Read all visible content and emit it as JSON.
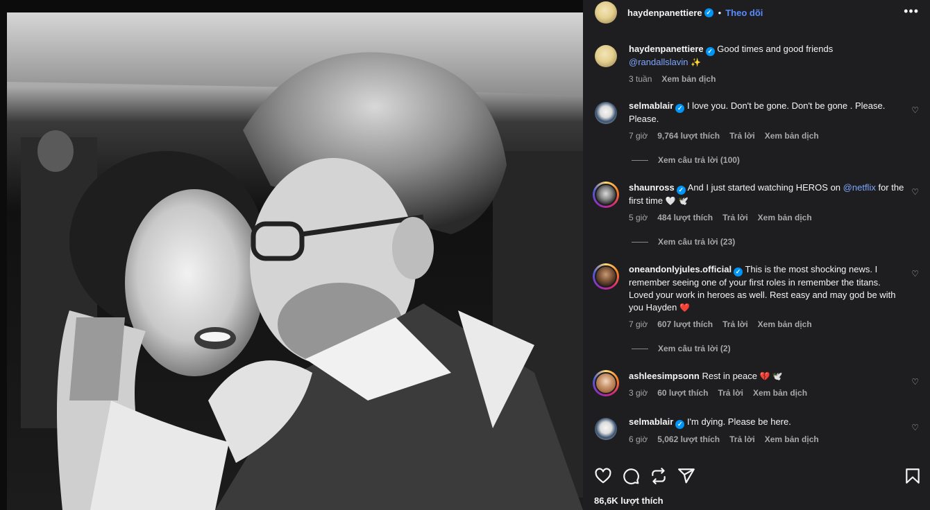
{
  "post": {
    "author": "haydenpanettiere",
    "follow_label": "Theo dõi",
    "separator": "•",
    "more_icon": "more-horizontal-icon",
    "caption": {
      "username": "haydenpanettiere",
      "text": "Good times and good friends",
      "mention": "@randallslavin",
      "emoji": "✨",
      "time": "3 tuần",
      "translate": "Xem bản dịch"
    },
    "likes_label": "86,6K lượt thích"
  },
  "comments": [
    {
      "username": "selmablair",
      "text": "I love you. Don't be gone. Don't be gone . Please. Please.",
      "time": "7 giờ",
      "likes": "9,764 lượt thích",
      "reply": "Trả lời",
      "translate": "Xem bản dịch",
      "view_replies": "Xem câu trả lời (100)"
    },
    {
      "username": "shaunross",
      "text_before": "And I just started watching HEROS on",
      "mention": "@netflix",
      "text_after": "for the first time",
      "emoji": "🤍 🕊️",
      "time": "5 giờ",
      "likes": "484 lượt thích",
      "reply": "Trả lời",
      "translate": "Xem bản dịch",
      "view_replies": "Xem câu trả lời (23)"
    },
    {
      "username": "oneandonlyjules.official",
      "text": "This is the most shocking news. I remember seeing one of your first roles in remember the titans. Loved your work in heroes as well. Rest easy and may god be with you Hayden",
      "emoji": "❤️",
      "time": "7 giờ",
      "likes": "607 lượt thích",
      "reply": "Trả lời",
      "translate": "Xem bản dịch",
      "view_replies": "Xem câu trả lời (2)"
    },
    {
      "username": "ashleesimpsonn",
      "text": "Rest in peace",
      "emoji": "💔 🕊️",
      "time": "3 giờ",
      "likes": "60 lượt thích",
      "reply": "Trả lời",
      "translate": "Xem bản dịch"
    },
    {
      "username": "selmablair",
      "text": "I'm dying. Please be here.",
      "time": "6 giờ",
      "likes": "5,062 lượt thích",
      "reply": "Trả lời",
      "translate": "Xem bản dịch"
    }
  ],
  "icons": {
    "like": "heart-icon",
    "comment": "comment-icon",
    "repost": "repost-icon",
    "share": "share-icon",
    "save": "bookmark-icon",
    "comment_like": "small-heart-icon",
    "verified": "verified-badge-icon"
  },
  "colors": {
    "panel_bg": "#1e1e20",
    "link": "#5a8cff",
    "verified": "#0095f6",
    "meta": "#a8a8a8"
  }
}
